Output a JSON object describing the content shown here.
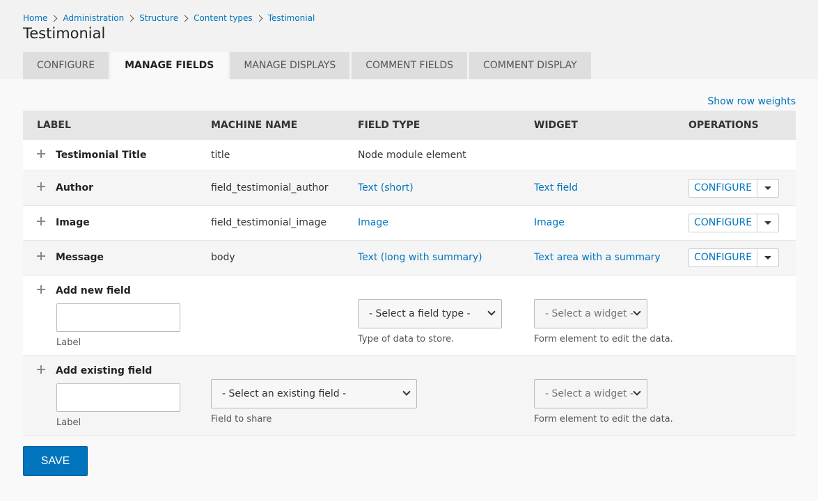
{
  "breadcrumb": [
    "Home",
    "Administration",
    "Structure",
    "Content types",
    "Testimonial"
  ],
  "page_title": "Testimonial",
  "tabs": [
    {
      "label": "Configure",
      "active": false
    },
    {
      "label": "Manage fields",
      "active": true
    },
    {
      "label": "Manage displays",
      "active": false
    },
    {
      "label": "Comment fields",
      "active": false
    },
    {
      "label": "Comment display",
      "active": false
    }
  ],
  "show_row_weights": "Show row weights",
  "table": {
    "headers": [
      "Label",
      "Machine name",
      "Field type",
      "Widget",
      "Operations"
    ],
    "rows": [
      {
        "label": "Testimonial Title",
        "machine_name": "title",
        "field_type": "Node module element",
        "widget": "",
        "operation": ""
      },
      {
        "label": "Author",
        "machine_name": "field_testimonial_author",
        "field_type": "Text (short)",
        "widget": "Text field",
        "operation": "Configure"
      },
      {
        "label": "Image",
        "machine_name": "field_testimonial_image",
        "field_type": "Image",
        "widget": "Image",
        "operation": "Configure"
      },
      {
        "label": "Message",
        "machine_name": "body",
        "field_type": "Text (long with summary)",
        "widget": "Text area with a summary",
        "operation": "Configure"
      }
    ]
  },
  "add_new_field": {
    "title": "Add new field",
    "label_help": "Label",
    "type_select": "- Select a field type -",
    "type_help": "Type of data to store.",
    "widget_select": "- Select a widget -",
    "widget_help": "Form element to edit the data."
  },
  "add_existing_field": {
    "title": "Add existing field",
    "label_help": "Label",
    "existing_select": "- Select an existing field -",
    "existing_help": "Field to share",
    "widget_select": "- Select a widget -",
    "widget_help": "Form element to edit the data."
  },
  "save_label": "Save",
  "colors": {
    "link": "#0074bd",
    "header_bg": "#f2f2f2",
    "tab_bg": "#dedede",
    "save_bg": "#0074bd"
  }
}
